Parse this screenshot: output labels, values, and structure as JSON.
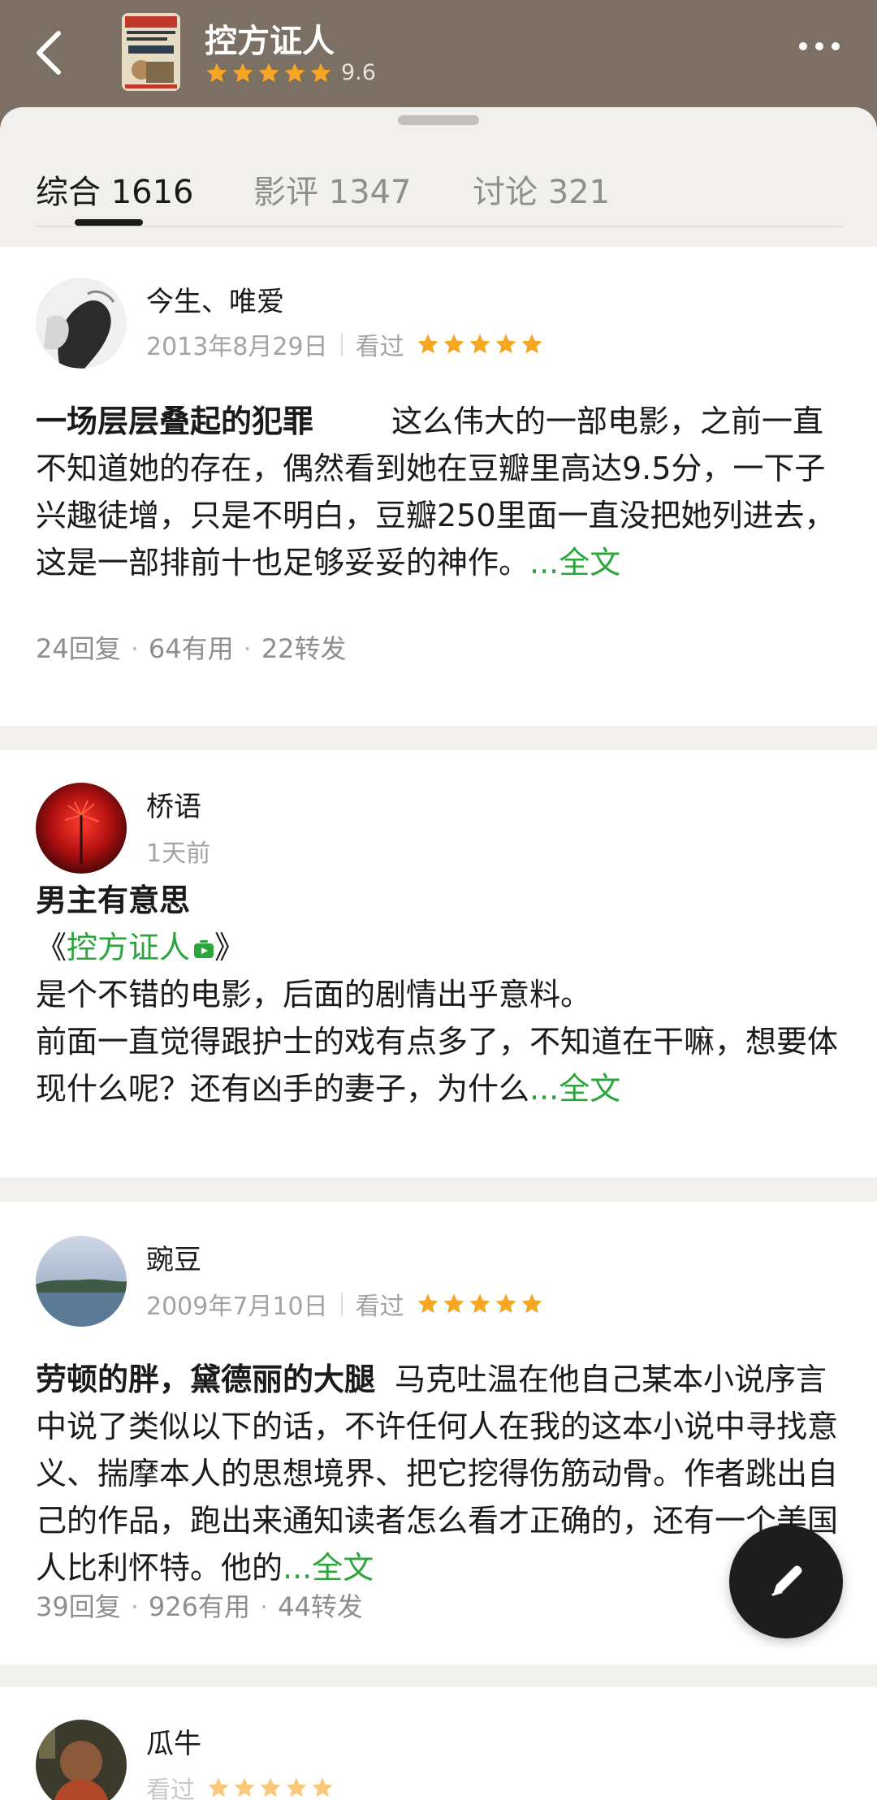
{
  "header": {
    "title": "控方证人",
    "rating": "9.6",
    "stars": 5
  },
  "tabs": [
    {
      "label": "综合 1616",
      "active": true
    },
    {
      "label": "影评 1347",
      "active": false
    },
    {
      "label": "讨论 321",
      "active": false
    }
  ],
  "reviews": [
    {
      "author": "今生、唯爱",
      "date": "2013年8月29日",
      "status": "看过",
      "stars": 5,
      "headline": "一场层层叠起的犯罪",
      "text": "这么伟大的一部电影，之前一直不知道她的存在，偶然看到她在豆瓣里高达9.5分，一下子兴趣徒增，只是不明白，豆瓣250里面一直没把她列进去，这是一部排前十也足够妥妥的神作。",
      "more": "...全文",
      "replies": "24回复",
      "useful": "64有用",
      "shares": "22转发"
    },
    {
      "author": "桥语",
      "date": "1天前",
      "headline": "男主有意思",
      "link_open": "《",
      "link_text": "控方证人",
      "link_close": "》",
      "line1": "是个不错的电影，后面的剧情出乎意料。",
      "line2": "前面一直觉得跟护士的戏有点多了，不知道在干嘛，想要体现什么呢？还有凶手的妻子，为什么",
      "more": "...全文"
    },
    {
      "author": "豌豆",
      "date": "2009年7月10日",
      "status": "看过",
      "stars": 5,
      "headline": "劳顿的胖，黛德丽的大腿",
      "text": "马克吐温在他自己某本小说序言中说了类似以下的话，不许任何人在我的这本小说中寻找意义、揣摩本人的思想境界、把它挖得伤筋动骨。作者跳出自己的作品，跑出来通知读者怎么看才正确的，还有一个美国人比利怀特。他的",
      "more": "...全文",
      "replies": "39回复",
      "useful": "926有用",
      "shares": "44转发"
    },
    {
      "author": "瓜牛",
      "status": "看过",
      "stars": 5
    }
  ],
  "colors": {
    "header_bg": "#7c6f64",
    "star": "#f5a623",
    "link": "#2ca63c"
  },
  "icons": [
    "back-arrow-icon",
    "more-dots-icon",
    "star-icon",
    "play-badge-icon",
    "pencil-icon"
  ]
}
